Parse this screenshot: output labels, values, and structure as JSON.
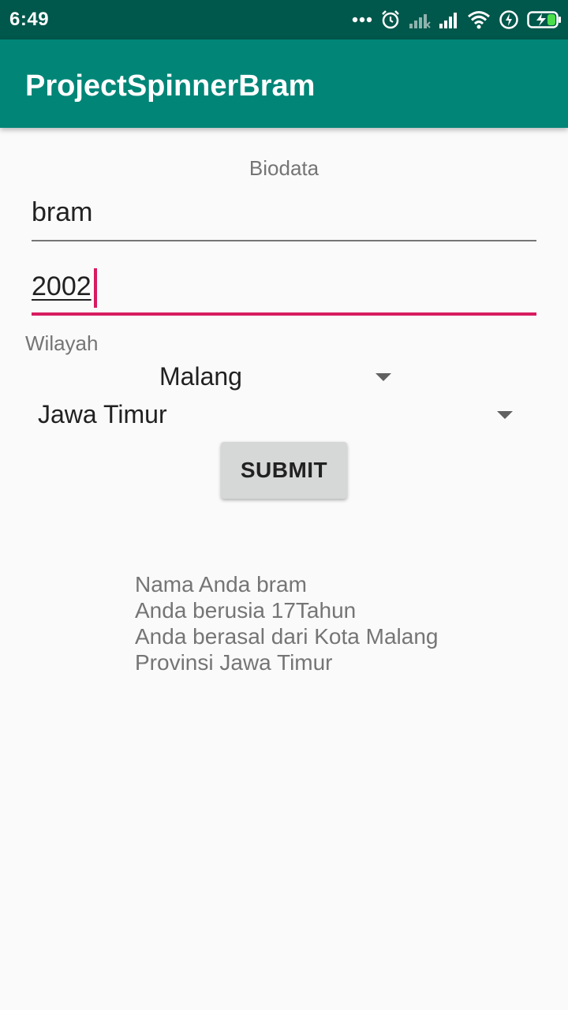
{
  "status_bar": {
    "time": "6:49",
    "icons": [
      "more-dots-icon",
      "alarm-icon",
      "signal-weak-icon",
      "signal-icon",
      "wifi-icon",
      "data-saver-icon",
      "battery-charging-icon"
    ]
  },
  "app_bar": {
    "title": "ProjectSpinnerBram"
  },
  "form": {
    "heading": "Biodata",
    "name_value": "bram",
    "year_value": "2002",
    "region_label": "Wilayah",
    "city_spinner": {
      "selected": "Malang"
    },
    "province_spinner": {
      "selected": "Jawa Timur"
    },
    "submit_label": "SUBMIT"
  },
  "result": {
    "lines": [
      "Nama Anda bram",
      "Anda berusia 17Tahun",
      "Anda berasal dari Kota Malang",
      "Provinsi Jawa Timur"
    ]
  },
  "colors": {
    "status_bar": "#00574b",
    "app_bar": "#008577",
    "accent": "#d81b60",
    "background": "#fafafa"
  }
}
